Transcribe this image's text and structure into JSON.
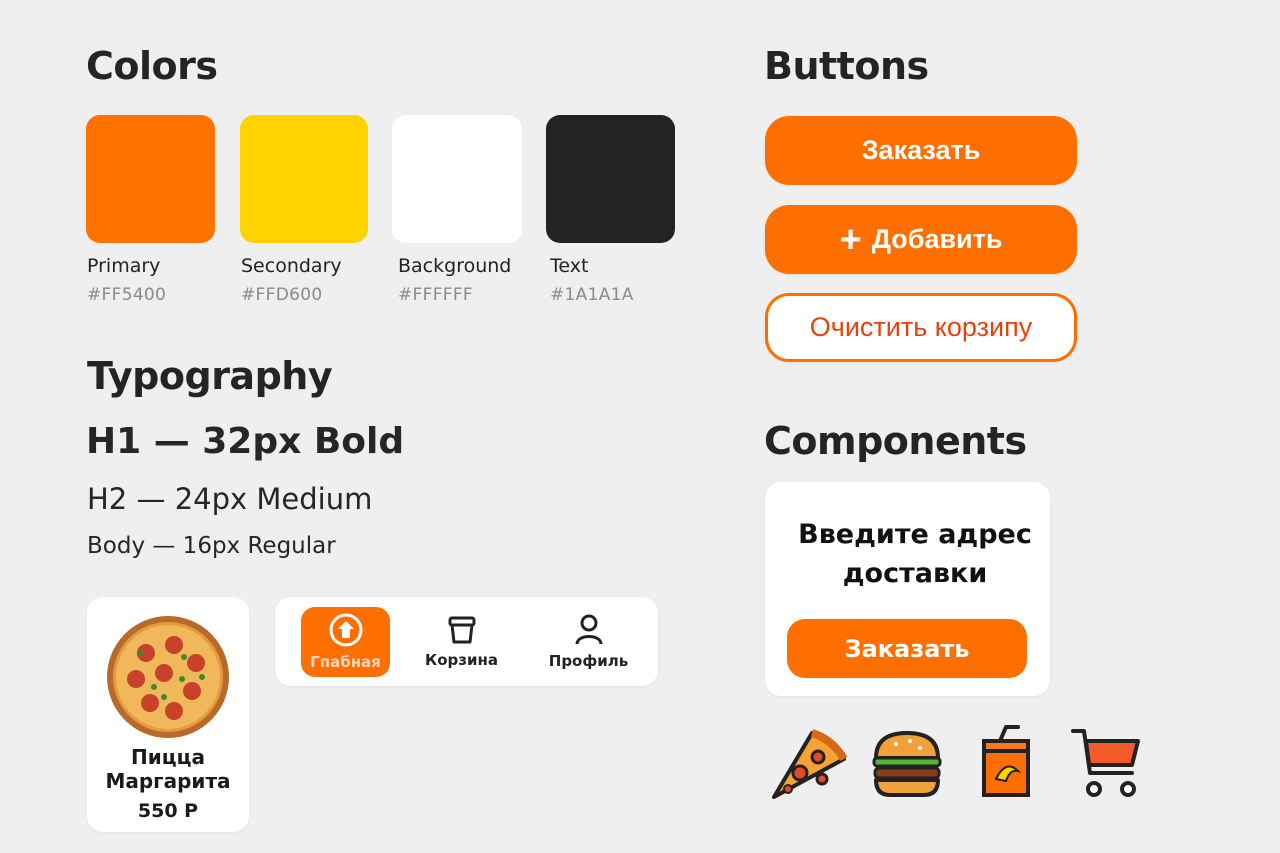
{
  "colors": {
    "title": "Colors",
    "swatches": [
      {
        "name": "Primary",
        "hex": "#FF5400",
        "display": "#ff7200"
      },
      {
        "name": "Secondary",
        "hex": "#FFD600",
        "display": "#ffd200"
      },
      {
        "name": "Background",
        "hex": "#FFFFFF",
        "display": "#ffffff"
      },
      {
        "name": "Text",
        "hex": "#1A1A1A",
        "display": "#232323"
      }
    ]
  },
  "typography": {
    "title": "Typography",
    "h1": "H1 — 32px Bold",
    "h2": "H2 — 24px Medium",
    "body": "Body — 16px Regular"
  },
  "buttons": {
    "title": "Buttons",
    "primary_label": "Заказать",
    "add_label": "Добавить",
    "outline_label": "Очистить корзипу"
  },
  "components": {
    "title": "Components",
    "address_prompt_line1": "Введите адрес",
    "address_prompt_line2": "доставки",
    "address_button": "Заказать"
  },
  "product_card": {
    "name_line1": "Пицца",
    "name_line2": "Маргарита",
    "price": "550 Р"
  },
  "nav_bar": {
    "items": [
      {
        "label": "Гпабная",
        "icon": "home-icon",
        "active": true
      },
      {
        "label": "Корзина",
        "icon": "basket-icon",
        "active": false
      },
      {
        "label": "Профиль",
        "icon": "profile-icon",
        "active": false
      }
    ]
  },
  "food_icons": [
    "pizza-slice-icon",
    "burger-icon",
    "drink-icon",
    "cart-icon"
  ],
  "accent_color": "#ff6f00"
}
